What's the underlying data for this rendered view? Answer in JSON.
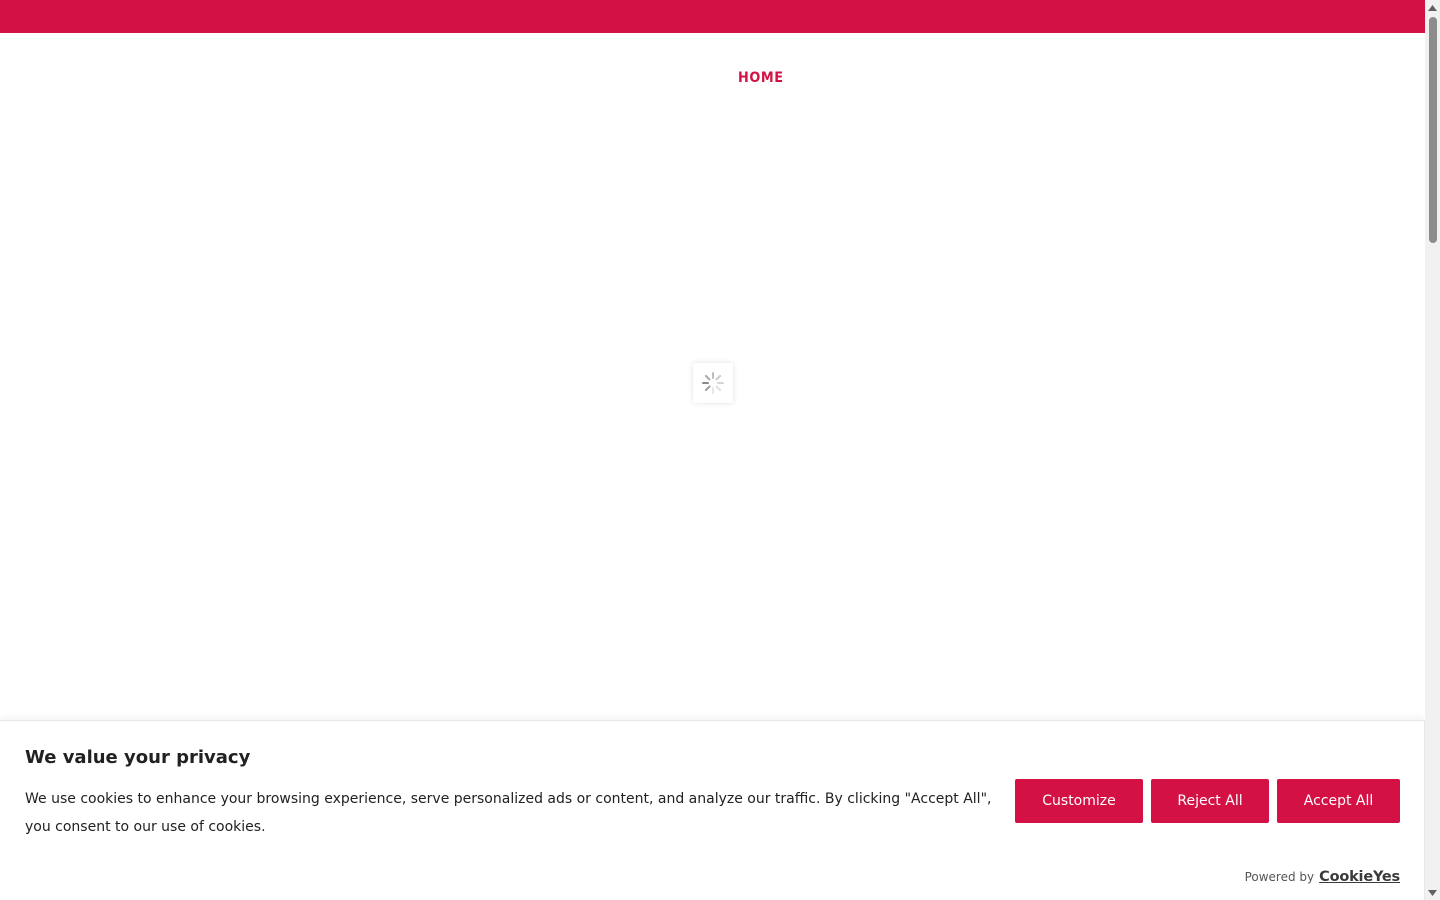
{
  "colors": {
    "brand": "#d31145",
    "text": "#212121",
    "muted": "#555555"
  },
  "nav": {
    "home_label": "HOME"
  },
  "loader": {
    "icon": "spinner-icon"
  },
  "cookie_banner": {
    "title": "We value your privacy",
    "description": "We use cookies to enhance your browsing experience, serve personalized ads or content, and analyze our traffic. By clicking \"Accept All\", you consent to our use of cookies.",
    "customize_label": "Customize",
    "reject_label": "Reject All",
    "accept_label": "Accept All",
    "powered_by_label": "Powered by",
    "powered_by_brand": "CookieYes"
  }
}
